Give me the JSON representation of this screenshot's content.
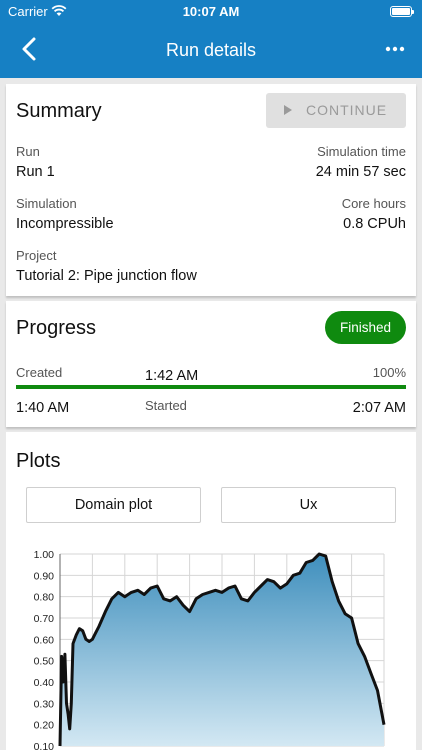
{
  "status_bar": {
    "carrier": "Carrier",
    "time": "10:07 AM"
  },
  "nav": {
    "title": "Run details",
    "back_icon": "chevron-left-icon",
    "more_icon": "more-horizontal-icon"
  },
  "summary": {
    "heading": "Summary",
    "continue_label": "CONTINUE",
    "run_label": "Run",
    "run_value": "Run 1",
    "simtime_label": "Simulation time",
    "simtime_value": "24 min 57 sec",
    "simulation_label": "Simulation",
    "simulation_value": "Incompressible",
    "corehours_label": "Core hours",
    "corehours_value": "0.8 CPUh",
    "project_label": "Project",
    "project_value": "Tutorial 2: Pipe junction flow"
  },
  "progress": {
    "heading": "Progress",
    "status": "Finished",
    "status_color": "#0f8a0f",
    "created_label": "Created",
    "created_time": "1:42 AM",
    "percent_label": "100%",
    "percent": 1.0,
    "start_time": "1:40 AM",
    "started_label": "Started",
    "end_time": "2:07 AM"
  },
  "plots": {
    "heading": "Plots",
    "buttons": [
      "Domain plot",
      "Ux"
    ]
  },
  "chart_data": {
    "type": "area",
    "title": "",
    "xlabel": "",
    "ylabel": "",
    "ylim": [
      0.1,
      1.0
    ],
    "y_ticks": [
      "1.00",
      "0.90",
      "0.80",
      "0.70",
      "0.60",
      "0.50",
      "0.40",
      "0.30",
      "0.20",
      "0.10"
    ],
    "grid": true,
    "line_color": "#111111",
    "fill_top_color": "#3f8fbd",
    "fill_bottom_color": "#d3e8f3",
    "x": [
      0.0,
      0.005,
      0.01,
      0.015,
      0.02,
      0.025,
      0.03,
      0.035,
      0.04,
      0.05,
      0.06,
      0.07,
      0.08,
      0.09,
      0.1,
      0.11,
      0.12,
      0.14,
      0.16,
      0.18,
      0.2,
      0.22,
      0.24,
      0.26,
      0.28,
      0.3,
      0.32,
      0.34,
      0.36,
      0.38,
      0.4,
      0.42,
      0.44,
      0.46,
      0.48,
      0.5,
      0.52,
      0.54,
      0.56,
      0.58,
      0.6,
      0.62,
      0.64,
      0.66,
      0.68,
      0.7,
      0.72,
      0.74,
      0.76,
      0.78,
      0.8,
      0.82,
      0.84,
      0.86,
      0.88,
      0.9,
      0.92,
      0.94,
      0.96,
      0.98,
      1.0
    ],
    "y": [
      0.1,
      0.52,
      0.4,
      0.53,
      0.3,
      0.25,
      0.18,
      0.3,
      0.58,
      0.62,
      0.65,
      0.64,
      0.6,
      0.59,
      0.6,
      0.63,
      0.66,
      0.73,
      0.79,
      0.82,
      0.8,
      0.82,
      0.83,
      0.81,
      0.84,
      0.85,
      0.79,
      0.78,
      0.8,
      0.76,
      0.73,
      0.79,
      0.81,
      0.82,
      0.83,
      0.82,
      0.84,
      0.85,
      0.79,
      0.78,
      0.82,
      0.85,
      0.88,
      0.87,
      0.84,
      0.86,
      0.9,
      0.91,
      0.96,
      0.97,
      1.0,
      0.99,
      0.87,
      0.78,
      0.72,
      0.7,
      0.58,
      0.52,
      0.44,
      0.36,
      0.2
    ]
  }
}
